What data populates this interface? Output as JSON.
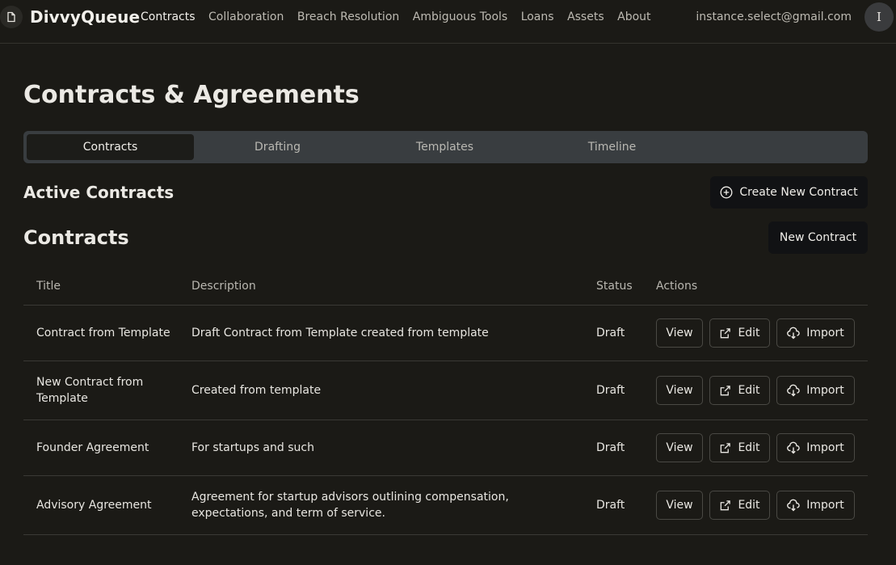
{
  "header": {
    "brand": "DivvyQueue",
    "nav": [
      {
        "label": "Contracts",
        "active": true
      },
      {
        "label": "Collaboration",
        "active": false
      },
      {
        "label": "Breach Resolution",
        "active": false
      },
      {
        "label": "Ambiguous Tools",
        "active": false
      },
      {
        "label": "Loans",
        "active": false
      },
      {
        "label": "Assets",
        "active": false
      },
      {
        "label": "About",
        "active": false
      }
    ],
    "user_email": "instance.select@gmail.com",
    "avatar_initial": "I"
  },
  "page": {
    "title": "Contracts & Agreements",
    "tabs": [
      {
        "label": "Contracts",
        "active": true
      },
      {
        "label": "Drafting",
        "active": false
      },
      {
        "label": "Templates",
        "active": false
      },
      {
        "label": "Timeline",
        "active": false
      }
    ],
    "active_section_title": "Active Contracts",
    "create_button": "Create New Contract",
    "contracts_title": "Contracts",
    "new_button": "New Contract"
  },
  "table": {
    "columns": {
      "title": "Title",
      "description": "Description",
      "status": "Status",
      "actions": "Actions"
    },
    "action_labels": {
      "view": "View",
      "edit": "Edit",
      "import": "Import"
    },
    "rows": [
      {
        "title": "Contract from Template",
        "description": "Draft Contract from Template created from template",
        "status": "Draft"
      },
      {
        "title": "New Contract from Template",
        "description": "Created from template",
        "status": "Draft"
      },
      {
        "title": "Founder Agreement",
        "description": "For startups and such",
        "status": "Draft"
      },
      {
        "title": "Advisory Agreement",
        "description": "Agreement for startup advisors outlining compensation, expectations, and term of service.",
        "status": "Draft"
      }
    ]
  }
}
